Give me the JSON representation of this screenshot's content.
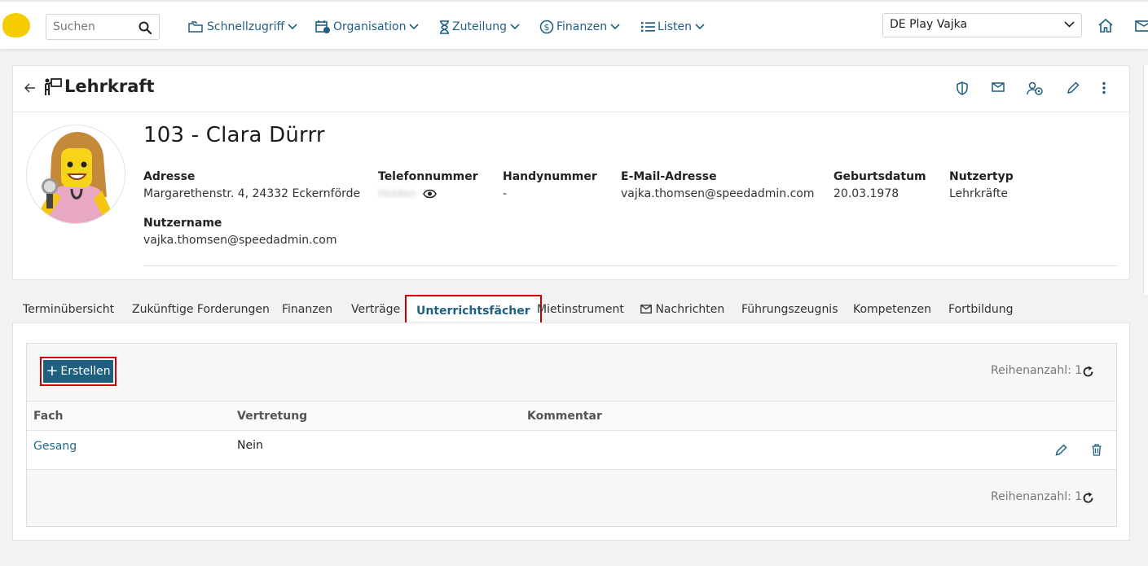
{
  "topbar": {
    "search_placeholder": "Suchen",
    "nav": [
      {
        "label": "Schnellzugriff",
        "icon": "folders-icon"
      },
      {
        "label": "Organisation",
        "icon": "calendar-clock-icon"
      },
      {
        "label": "Zuteilung",
        "icon": "hourglass-icon"
      },
      {
        "label": "Finanzen",
        "icon": "dollar-circle-icon"
      },
      {
        "label": "Listen",
        "icon": "list-icon"
      }
    ],
    "school_selected": "DE Play Vajka",
    "icons": [
      "home-icon",
      "mail-icon"
    ]
  },
  "card": {
    "title": "Lehrkraft",
    "name": "103 - Clara Dürrr",
    "fields": {
      "address_label": "Adresse",
      "address_value": "Margarethenstr. 4, 24332 Eckernförde",
      "phone_label": "Telefonnummer",
      "phone_value": "Hidden",
      "mobile_label": "Handynummer",
      "mobile_value": "-",
      "email_label": "E-Mail-Adresse",
      "email_value": "vajka.thomsen@speedadmin.com",
      "birth_label": "Geburtsdatum",
      "birth_value": "20.03.1978",
      "usertype_label": "Nutzertyp",
      "usertype_value": "Lehrkräfte",
      "username_label": "Nutzername",
      "username_value": "vajka.thomsen@speedadmin.com"
    }
  },
  "tabs": [
    "Terminübersicht",
    "Zukünftige Forderungen",
    "Finanzen",
    "Verträge",
    "Unterrichtsfächer",
    "Mietinstrument",
    "Nachrichten",
    "Führungszeugnis",
    "Kompetenzen",
    "Fortbildung"
  ],
  "active_tab": "Unterrichtsfächer",
  "grid": {
    "create_label": "Erstellen",
    "row_count_text": "Reihenanzahl: 1",
    "columns": [
      "Fach",
      "Vertretung",
      "Kommentar"
    ],
    "rows": [
      {
        "fach": "Gesang",
        "vertretung": "Nein",
        "kommentar": ""
      }
    ]
  },
  "colors": {
    "accent": "#1f5f80",
    "highlight_border": "#d40000",
    "logo": "#f5cc00"
  }
}
